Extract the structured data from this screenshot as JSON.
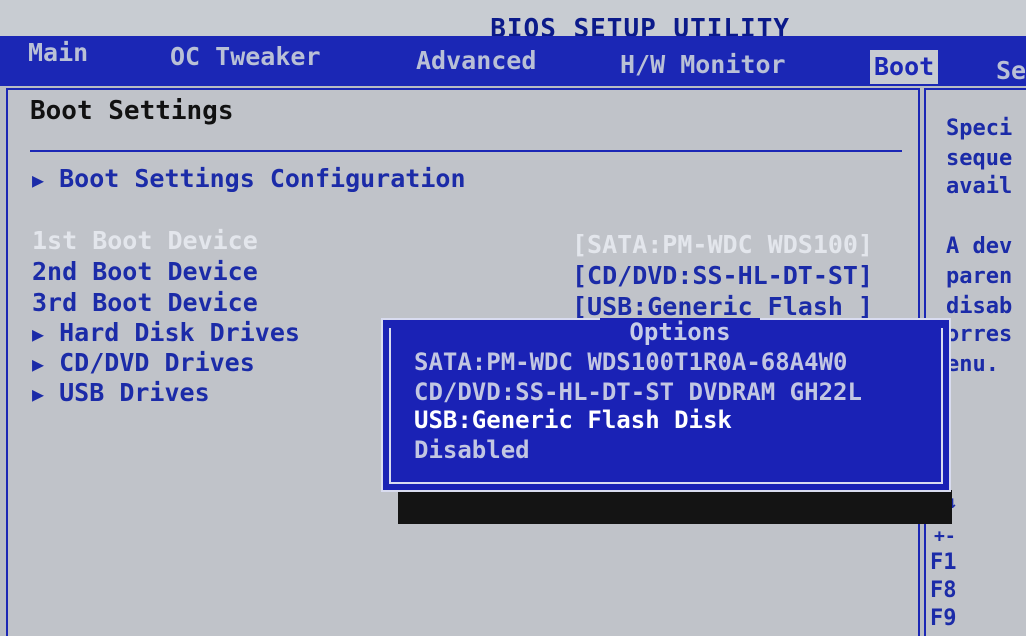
{
  "app": {
    "title": "BIOS SETUP UTILITY"
  },
  "menu": {
    "items": [
      {
        "label": "Main"
      },
      {
        "label": "OC Tweaker"
      },
      {
        "label": "Advanced"
      },
      {
        "label": "H/W Monitor"
      },
      {
        "label": "Boot"
      },
      {
        "label": "Se"
      }
    ],
    "active": "Boot"
  },
  "section": {
    "title": "Boot Settings",
    "submenu_config": "Boot Settings Configuration"
  },
  "boot_order": [
    {
      "label": "1st Boot Device",
      "value": "[SATA:PM-WDC WDS100]"
    },
    {
      "label": "2nd Boot Device",
      "value": "[CD/DVD:SS-HL-DT-ST]"
    },
    {
      "label": "3rd Boot Device",
      "value": "[USB:Generic Flash ]"
    }
  ],
  "submenus": [
    {
      "label": "Hard Disk Drives"
    },
    {
      "label": "CD/DVD Drives"
    },
    {
      "label": "USB Drives"
    }
  ],
  "popup": {
    "title": "Options",
    "options": [
      "SATA:PM-WDC WDS100T1R0A-68A4W0",
      "CD/DVD:SS-HL-DT-ST DVDRAM GH22L",
      "USB:Generic Flash Disk",
      "Disabled"
    ],
    "selected_index": 2
  },
  "help": {
    "lines1": [
      "Speci",
      "seque",
      "avail"
    ],
    "lines2": [
      "A dev",
      "paren",
      "disab",
      "orres",
      "enu."
    ],
    "keys": [
      "↑↓",
      "+-",
      "F1",
      "F8",
      "F9"
    ]
  },
  "colors": {
    "accent": "#1b27b5",
    "panel": "#c0c3c9"
  }
}
